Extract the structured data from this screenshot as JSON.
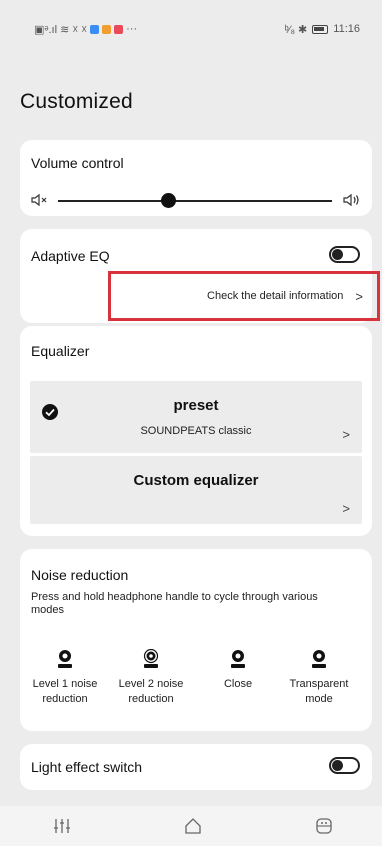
{
  "status_bar": {
    "left_indicators": "▣ᵊ.ıl ≋ ☓ ☓",
    "more": "···",
    "right_indicators": "ᵇ⁄₈ ✱",
    "time": "11:16",
    "app_badge_colors": [
      "#3a8df5",
      "#f29d2f",
      "#e84a5a"
    ]
  },
  "page": {
    "title": "Customized"
  },
  "volume": {
    "title": "Volume control",
    "level": 0.4,
    "mute_icon": "speaker-mute-icon",
    "loud_icon": "speaker-loud-icon"
  },
  "adaptive_eq": {
    "title": "Adaptive EQ",
    "enabled": false,
    "detail_link": "Check the detail information",
    "highlight_color": "#d8323d"
  },
  "equalizer": {
    "title": "Equalizer",
    "preset": {
      "label": "preset",
      "selected_value": "SOUNDPEATS classic",
      "selected": true
    },
    "custom": {
      "label": "Custom equalizer"
    }
  },
  "noise_reduction": {
    "title": "Noise reduction",
    "description": "Press and hold headphone handle to cycle through various modes",
    "modes": [
      {
        "line1": "Level 1 noise",
        "line2": "reduction",
        "icon": "anc-level1-icon"
      },
      {
        "line1": "Level 2 noise",
        "line2": "reduction",
        "icon": "anc-level2-icon"
      },
      {
        "line1": "Close",
        "line2": "",
        "icon": "anc-off-icon"
      },
      {
        "line1": "Transparent",
        "line2": "mode",
        "icon": "transparent-mode-icon"
      }
    ]
  },
  "light_effect": {
    "title": "Light effect switch",
    "enabled": false
  },
  "bottom_nav": {
    "items": [
      {
        "icon": "equalizer-sliders-icon"
      },
      {
        "icon": "home-icon"
      },
      {
        "icon": "earbuds-case-icon"
      }
    ]
  }
}
